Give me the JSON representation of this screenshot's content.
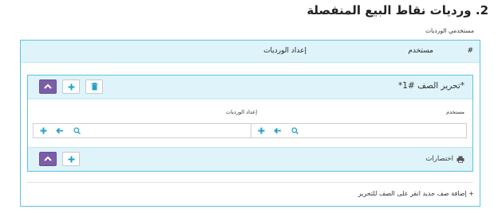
{
  "page": {
    "title": "2. ورديات نقاط البيع المنفصلة",
    "section_label": "مستخدمي الورديات"
  },
  "table": {
    "headers": {
      "hash": "#",
      "user": "مستخدم",
      "shift_settings": "إعداد الورديات"
    }
  },
  "edit_row": {
    "title": "*تحرير الصف #1*",
    "columns": {
      "user": "مستخدم",
      "shift_settings": "إعداد الورديات"
    },
    "footer": {
      "shortcuts_label": "اختصارات"
    }
  },
  "add_row_hint": "+ إضافة صف جديد انقر على الصف للتحرير",
  "colors": {
    "accent_border": "#5cc3de",
    "header_bg": "#def4fa",
    "purple_button": "#7b5ea7",
    "icon_teal": "#1fa3c4"
  },
  "icons": [
    "trash-icon",
    "plus-icon",
    "chevron-up-icon",
    "search-icon",
    "arrow-left-icon",
    "printer-icon"
  ]
}
